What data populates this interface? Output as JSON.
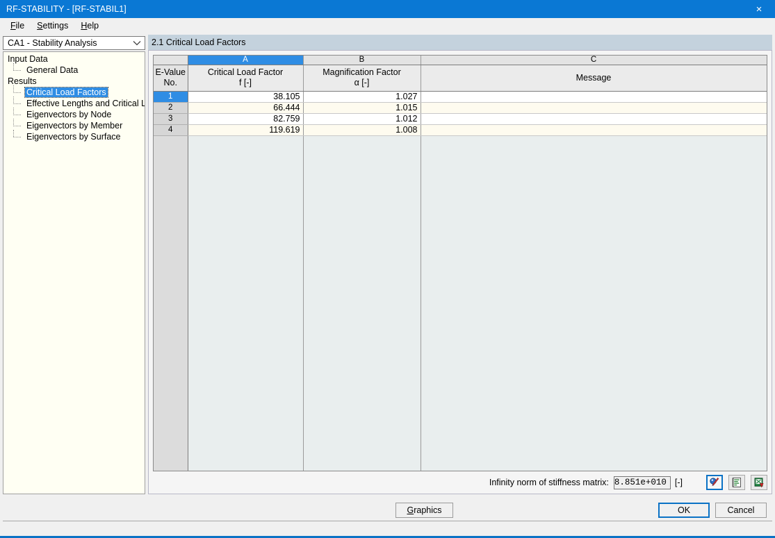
{
  "window": {
    "title": "RF-STABILITY - [RF-STABIL1]",
    "close_label": "×",
    "accent_color": "#0a78d4"
  },
  "menubar": {
    "items": [
      {
        "label": "File",
        "accel": "F"
      },
      {
        "label": "Settings",
        "accel": "S"
      },
      {
        "label": "Help",
        "accel": "H"
      }
    ]
  },
  "sidebar": {
    "combo": {
      "value": "CA1 - Stability Analysis",
      "icon": "chevron-down-icon"
    },
    "tree": [
      {
        "label": "Input Data",
        "level": 0,
        "selected": false,
        "stem": false
      },
      {
        "label": "General Data",
        "level": 1,
        "selected": false,
        "stem": true,
        "last": true
      },
      {
        "label": "Results",
        "level": 0,
        "selected": false,
        "stem": false
      },
      {
        "label": "Critical Load Factors",
        "level": 1,
        "selected": true,
        "stem": true,
        "last": false
      },
      {
        "label": "Effective Lengths and Critical Loads",
        "level": 1,
        "selected": false,
        "stem": true,
        "last": false
      },
      {
        "label": "Eigenvectors by Node",
        "level": 1,
        "selected": false,
        "stem": true,
        "last": false
      },
      {
        "label": "Eigenvectors by Member",
        "level": 1,
        "selected": false,
        "stem": true,
        "last": false
      },
      {
        "label": "Eigenvectors by Surface",
        "level": 1,
        "selected": false,
        "stem": true,
        "last": true
      }
    ],
    "toolbar": [
      {
        "name": "help-button",
        "icon": "question-mark-icon"
      },
      {
        "name": "previous-button",
        "icon": "arrow-left-icon"
      },
      {
        "name": "next-button",
        "icon": "arrow-right-icon"
      }
    ]
  },
  "panel": {
    "header": "2.1 Critical Load Factors"
  },
  "table": {
    "column_letters": [
      "",
      "A",
      "B",
      "C"
    ],
    "selected_letter": "A",
    "corner_header": {
      "line1": "E-Value",
      "line2": "No."
    },
    "columns": [
      {
        "letter": "A",
        "line1": "Critical Load Factor",
        "line2": "f [-]"
      },
      {
        "letter": "B",
        "line1": "Magnification Factor",
        "line2": "α [-]"
      },
      {
        "letter": "C",
        "line1": "Message",
        "line2": ""
      }
    ],
    "rows": [
      {
        "no": "1",
        "critical_load_factor": "38.105",
        "magnification_factor": "1.027",
        "message": "",
        "selected": true
      },
      {
        "no": "2",
        "critical_load_factor": "66.444",
        "magnification_factor": "1.015",
        "message": "",
        "selected": false
      },
      {
        "no": "3",
        "critical_load_factor": "82.759",
        "magnification_factor": "1.012",
        "message": "",
        "selected": false
      },
      {
        "no": "4",
        "critical_load_factor": "119.619",
        "magnification_factor": "1.008",
        "message": "",
        "selected": false
      }
    ]
  },
  "status": {
    "label": "Infinity norm of stiffness matrix:",
    "value": "8.851e+010",
    "unit": "[-]",
    "icons": [
      {
        "name": "view-selection-icon",
        "active": true
      },
      {
        "name": "printout-report-icon",
        "active": false
      },
      {
        "name": "export-to-excel-icon",
        "active": false
      }
    ]
  },
  "footer": {
    "graphics_label": "Graphics",
    "graphics_accel": "G",
    "ok_label": "OK",
    "cancel_label": "Cancel"
  }
}
